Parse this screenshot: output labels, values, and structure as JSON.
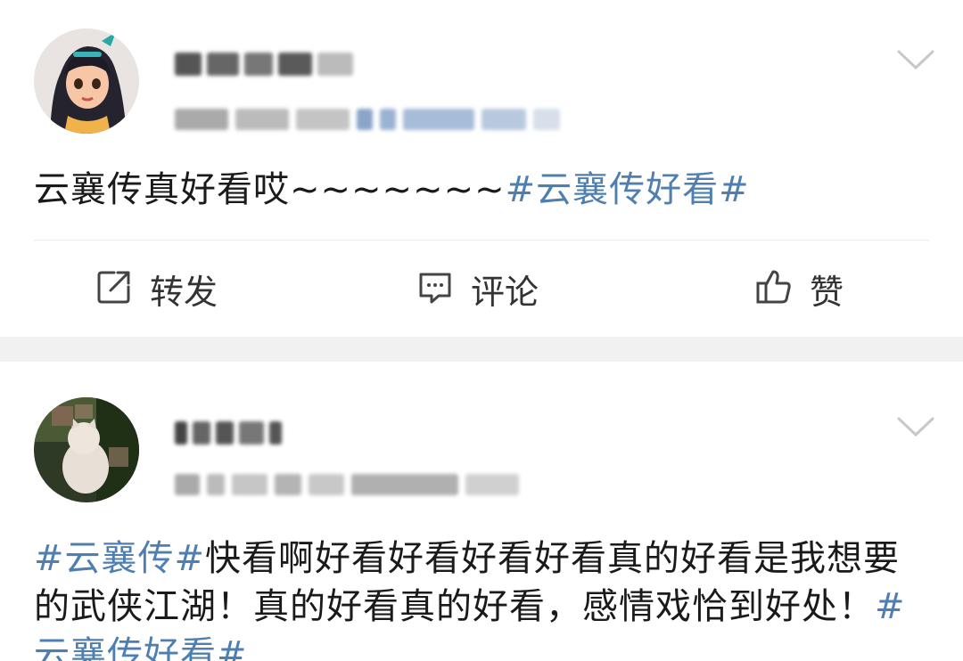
{
  "post1": {
    "text": "云襄传真好看哎~~~~~~~",
    "hashtag": "#云襄传好看#",
    "actions": {
      "repost": "转发",
      "comment": "评论",
      "like": "赞"
    }
  },
  "post2": {
    "hashtag_lead": "#云襄传#",
    "text": "快看啊好看好看好看好看真的好看是我想要的武侠江湖！真的好看真的好看，感情戏恰到好处！",
    "hashtag_tail": "#云襄传好看#"
  },
  "colors": {
    "hashtag": "#4f7fb0",
    "separator": "#f1f1f1"
  },
  "icons": {
    "options": "chevron-down-icon",
    "repost": "repost-icon",
    "comment": "comment-icon",
    "like": "thumbs-up-icon"
  }
}
